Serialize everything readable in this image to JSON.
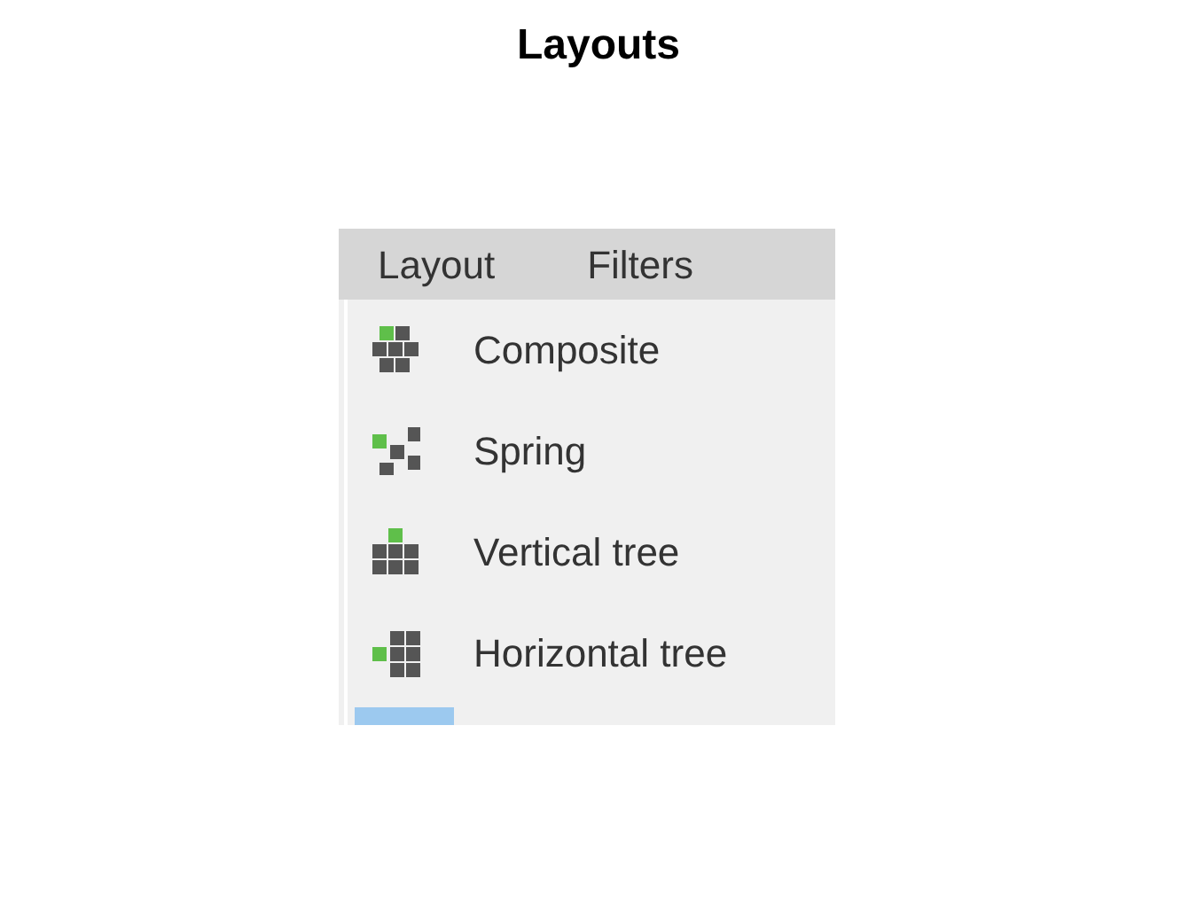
{
  "slide": {
    "title": "Layouts"
  },
  "menu_bar": [
    {
      "label": "Layout"
    },
    {
      "label": "Filters"
    }
  ],
  "menu": [
    {
      "kind": "composite",
      "label": "Composite"
    },
    {
      "kind": "spring",
      "label": "Spring"
    },
    {
      "kind": "vertical-tree",
      "label": "Vertical tree"
    },
    {
      "kind": "horizontal-tree",
      "label": "Horizontal tree"
    },
    {
      "kind": "partial"
    }
  ]
}
